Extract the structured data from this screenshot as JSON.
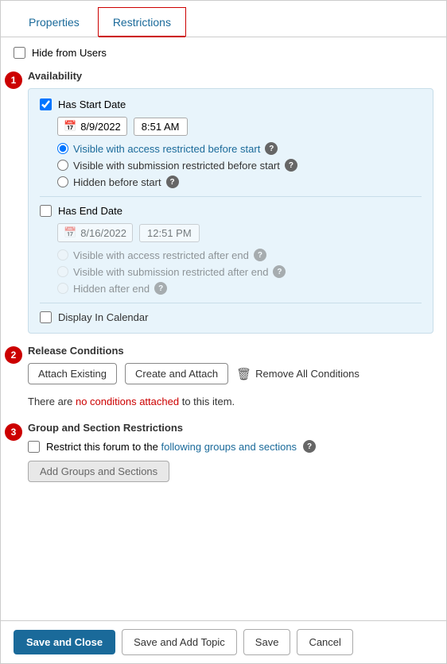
{
  "tabs": {
    "properties": {
      "label": "Properties"
    },
    "restrictions": {
      "label": "Restrictions"
    }
  },
  "active_tab": "Restrictions",
  "hide_from_users": {
    "label": "Hide from Users",
    "checked": false
  },
  "sections": {
    "availability": {
      "number": "1",
      "title": "Availability",
      "has_start_date": {
        "label": "Has Start Date",
        "checked": true,
        "date": "8/9/2022",
        "time": "8:51 AM",
        "options": [
          {
            "label": "Visible with access restricted before start",
            "selected": true
          },
          {
            "label": "Visible with submission restricted before start",
            "selected": false
          },
          {
            "label": "Hidden before start",
            "selected": false
          }
        ]
      },
      "has_end_date": {
        "label": "Has End Date",
        "checked": false,
        "date": "8/16/2022",
        "time": "12:51 PM",
        "options": [
          {
            "label": "Visible with access restricted after end",
            "selected": false
          },
          {
            "label": "Visible with submission restricted after end",
            "selected": false
          },
          {
            "label": "Hidden after end",
            "selected": false
          }
        ]
      },
      "display_in_calendar": {
        "label": "Display In Calendar",
        "checked": false
      }
    },
    "release_conditions": {
      "number": "2",
      "title": "Release Conditions",
      "attach_existing_label": "Attach Existing",
      "create_and_attach_label": "Create and Attach",
      "remove_all_label": "Remove All Conditions",
      "message": "There are no conditions attached to this item."
    },
    "group_section": {
      "number": "3",
      "title": "Group and Section Restrictions",
      "restrict_label_part1": "Restrict this forum to the",
      "restrict_label_part2": "following groups and sections",
      "checked": false,
      "add_button_label": "Add Groups and Sections"
    }
  },
  "footer": {
    "save_close_label": "Save and Close",
    "save_add_topic_label": "Save and Add Topic",
    "save_label": "Save",
    "cancel_label": "Cancel"
  }
}
